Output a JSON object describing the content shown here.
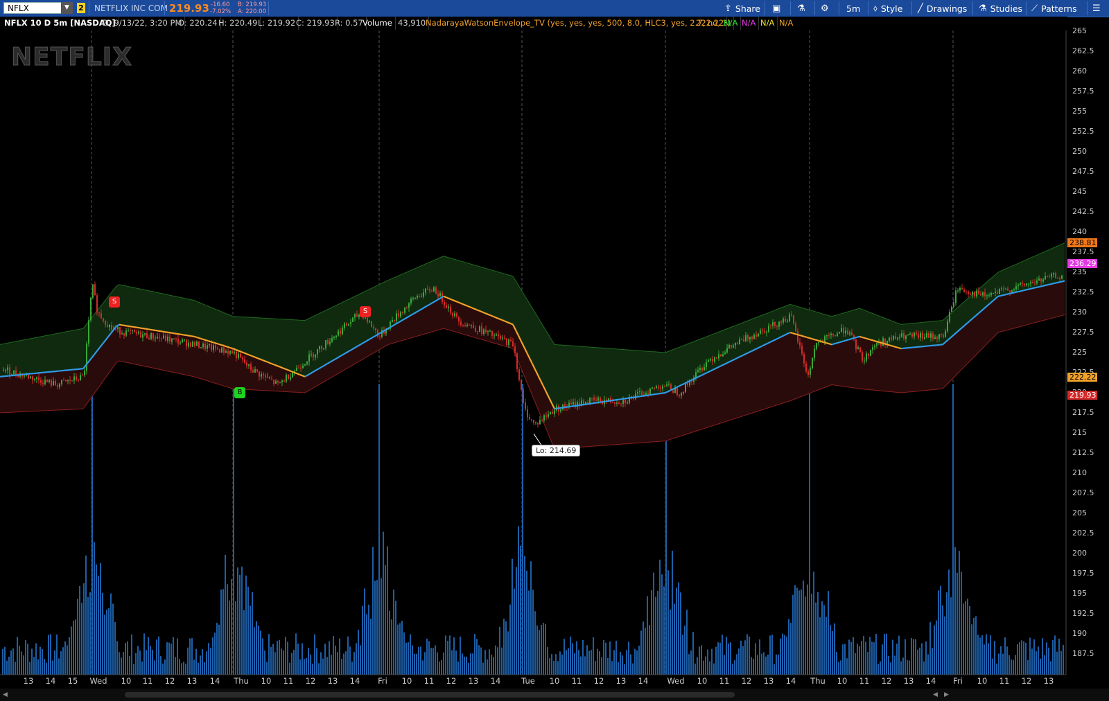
{
  "toolbar": {
    "symbol": "NFLX",
    "link_badge": "2",
    "company": "NETFLIX INC COM",
    "last": "219.93",
    "change": "-16.60",
    "change_pct": "-7.02%",
    "bid": "B: 219.93",
    "ask": "A: 220.00",
    "share": "Share",
    "timeframe": "5m",
    "style": "Style",
    "drawings": "Drawings",
    "studies": "Studies",
    "patterns": "Patterns"
  },
  "info": {
    "title": "NFLX 10 D 5m [NASDAQ]",
    "date": "D: 9/13/22, 3:20 PM",
    "open": "O: 220.24",
    "high": "H: 220.49",
    "low": "L: 219.92",
    "close": "C: 219.93",
    "range": "R: 0.57",
    "volume_label": "Volume",
    "volume": "43,910",
    "study": "NadarayaWatsonEnvelope_TV (yes, yes, yes, 500, 8.0, HLC3, yes, 2.7, no, 3)",
    "study_value": "222.22",
    "na1": "N/A",
    "na2": "N/A",
    "na3": "N/A",
    "na4": "N/A"
  },
  "logo": "NETFLIX",
  "low_label": "Lo: 214.69",
  "price_tags": {
    "upper": "238.81",
    "mid": "236.29",
    "study": "222.22",
    "last": "219.93"
  },
  "signals": {
    "sell": "S",
    "buy": "B"
  },
  "colors": {
    "up": "#3aa83a",
    "down": "#d42a2a",
    "envelope_green": "#0f2a0f",
    "envelope_red": "#2a0b0b",
    "line_blue": "#2f9be8",
    "line_orange": "#f2a22a",
    "volume": "#1d5fa8"
  },
  "chart_data": {
    "type": "line",
    "ylim": [
      186,
      266
    ],
    "y_ticks": [
      187.5,
      190,
      192.5,
      195,
      197.5,
      200,
      202.5,
      205,
      207.5,
      210,
      212.5,
      215,
      217.5,
      220,
      222.5,
      225,
      227.5,
      230,
      232.5,
      235,
      237.5,
      240,
      242.5,
      245,
      247.5,
      250,
      252.5,
      255,
      257.5,
      260,
      262.5,
      265
    ],
    "x_tick_labels": [
      "13",
      "14",
      "15",
      "Wed",
      "10",
      "11",
      "12",
      "13",
      "14",
      "Thu",
      "10",
      "11",
      "12",
      "13",
      "14",
      "Fri",
      "10",
      "11",
      "12",
      "13",
      "14",
      "Tue",
      "10",
      "11",
      "12",
      "13",
      "14",
      "Wed",
      "10",
      "11",
      "12",
      "13",
      "14",
      "Thu",
      "10",
      "11",
      "12",
      "13",
      "14",
      "Fri",
      "10",
      "11",
      "12",
      "13"
    ],
    "price_x": [
      0,
      40,
      80,
      120,
      132,
      140,
      160,
      180,
      220,
      280,
      336,
      360,
      400,
      440,
      480,
      520,
      547,
      565,
      600,
      625,
      660,
      700,
      740,
      755,
      770,
      800,
      850,
      900,
      955,
      980,
      1020,
      1080,
      1140,
      1165,
      1175,
      1220,
      1245,
      1260,
      1300,
      1360,
      1380,
      1420,
      1460,
      1520
    ],
    "price": [
      223,
      222,
      221,
      222,
      233.5,
      230,
      228,
      227.5,
      227,
      226,
      225,
      223,
      221,
      224,
      227,
      230,
      227,
      229,
      232,
      233,
      229,
      227.5,
      226,
      218,
      216,
      218,
      219,
      219,
      221,
      220,
      224,
      227,
      229.5,
      222,
      226,
      228,
      224,
      226,
      227,
      227,
      233,
      232,
      233,
      234.5
    ],
    "series": [
      {
        "name": "upper",
        "x": [
          0,
          120,
          170,
          280,
          336,
          440,
          560,
          640,
          740,
          800,
          960,
          1140,
          1200,
          1240,
          1300,
          1360,
          1440,
          1540
        ],
        "values": [
          226,
          228,
          233.5,
          231.5,
          229.5,
          229,
          234,
          237,
          234.5,
          226,
          225,
          231,
          229.5,
          230.5,
          228.5,
          229,
          235,
          238.8
        ]
      },
      {
        "name": "lower",
        "x": [
          0,
          120,
          170,
          280,
          336,
          440,
          560,
          640,
          740,
          800,
          960,
          1140,
          1200,
          1240,
          1300,
          1360,
          1440,
          1540
        ],
        "values": [
          217.5,
          218,
          224,
          222,
          220.5,
          220,
          226,
          228,
          225.5,
          213,
          214,
          219,
          221,
          220.5,
          220,
          220.5,
          227.5,
          229.8
        ]
      },
      {
        "name": "center",
        "x": [
          0,
          120,
          170,
          280,
          336,
          440,
          560,
          640,
          740,
          800,
          960,
          1140,
          1200,
          1240,
          1300,
          1360,
          1440,
          1540
        ],
        "values": [
          222,
          223,
          228.5,
          227,
          225.5,
          222,
          228,
          232,
          228.5,
          218,
          220,
          227.5,
          226,
          227,
          225.5,
          226,
          232,
          234
        ]
      }
    ],
    "volume": {
      "spikes_x": [
        132,
        336,
        547,
        753,
        960,
        1168,
        1375
      ],
      "spike_heights": [
        200,
        210,
        220,
        187,
        205,
        210,
        201
      ]
    }
  }
}
